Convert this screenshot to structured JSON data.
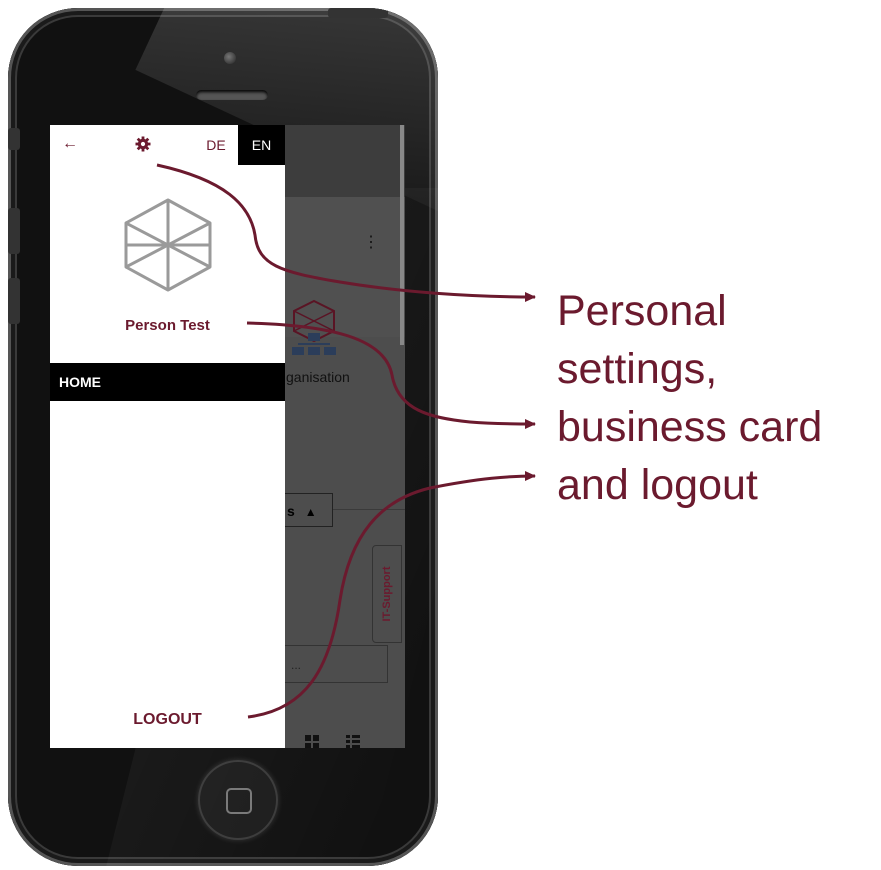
{
  "drawer": {
    "lang_de": "DE",
    "lang_en": "EN",
    "person_name": "Person Test",
    "nav_home": "HOME",
    "logout": "LOGOUT"
  },
  "background_app": {
    "org_label": "ganisation",
    "collapse_label": "s",
    "it_support": "IT-Support",
    "input_placeholder": "..."
  },
  "callout": {
    "lines": [
      "Personal",
      "settings,",
      "business card",
      "and logout"
    ]
  },
  "colors": {
    "accent": "#6b1a2e",
    "nav_active_bg": "#000000",
    "overlay": "#4d4d4d"
  },
  "icons": [
    "back-arrow-icon",
    "gear-icon",
    "cube-avatar-icon",
    "kebab-menu-icon",
    "org-chart-icon",
    "chevron-up-icon",
    "grid-view-icon",
    "list-view-icon",
    "home-button-icon"
  ]
}
